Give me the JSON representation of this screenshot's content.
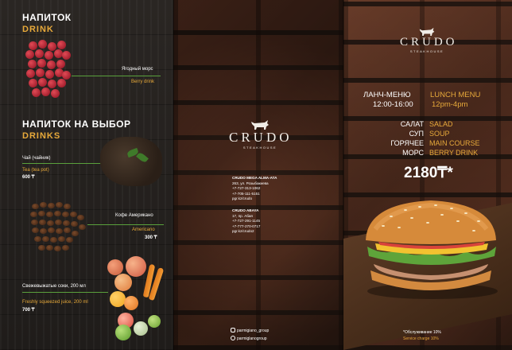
{
  "left": {
    "drink": {
      "title_ru": "НАПИТОК",
      "title_en": "DRINK"
    },
    "berry": {
      "name_ru": "Ягодный морс",
      "name_en": "Berry drink"
    },
    "drinks": {
      "title_ru": "НАПИТОК НА ВЫБОР",
      "title_en": "DRINKS"
    },
    "tea": {
      "name_ru": "Чай (чайник)",
      "name_en": "Tea (tea pot)",
      "price": "600 ₸"
    },
    "coffee": {
      "name_ru": "Кофе Американо",
      "name_en": "Americano",
      "price": "300 ₸"
    },
    "juice": {
      "name_ru": "Свежевыжатые соки, 200 мл",
      "name_en": "Freshly squeezed juice, 200 ml",
      "price": "700 ₸"
    }
  },
  "middle": {
    "logo_word": "CRUDO",
    "logo_sub": "STEAKHOUSE",
    "contacts": [
      {
        "heading": "CRUDO MEGA ALMA-ATA",
        "lines": [
          "263, ул. Розыбакиева",
          "+7-727-313-1062",
          "+7-705-111-5151",
          "pgr.kz/crudo"
        ]
      },
      {
        "heading": "CRUDO ABAYA",
        "lines": [
          "17, пр. Абая",
          "+7-727-291-1145",
          "+7-777-270-0717",
          "pgr.kz/crudo2"
        ]
      }
    ],
    "social": [
      "parmigiano_group",
      "parmiglanogroup"
    ]
  },
  "right": {
    "logo_word": "CRUDO",
    "logo_sub": "STEAKHOUSE",
    "menu_title_ru": "ЛАНЧ-МЕНЮ",
    "menu_title_en": "LUNCH MENU",
    "hours_ru": "12:00-16:00",
    "hours_en": "12pm-4pm",
    "items": [
      {
        "ru": "САЛАТ",
        "en": "SALAD"
      },
      {
        "ru": "СУП",
        "en": "SOUP"
      },
      {
        "ru": "ГОРЯЧЕЕ",
        "en": "MAIN COURSE"
      },
      {
        "ru": "МОРС",
        "en": "BERRY DRINK"
      }
    ],
    "price": "2180₸*",
    "note_ru": "*Обслуживание 10%",
    "note_en": "Service charge 10%"
  },
  "colors": {
    "accent": "#e7a93a",
    "green_line": "#5aa03c"
  }
}
